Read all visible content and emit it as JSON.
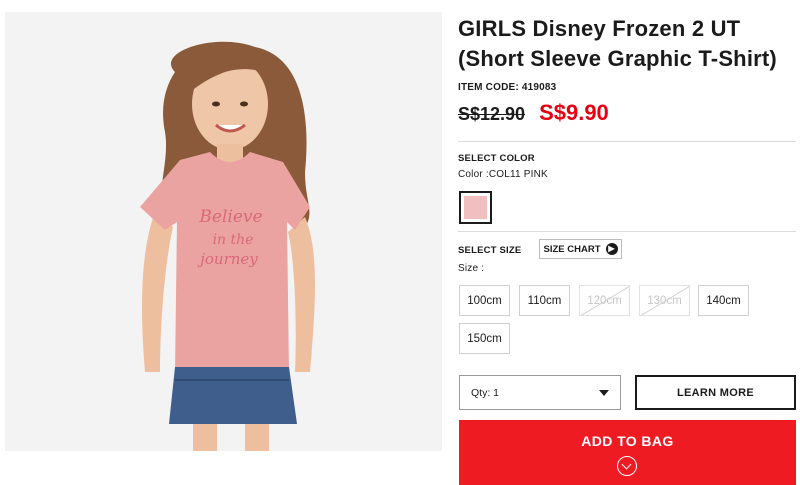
{
  "product": {
    "title_line1": "GIRLS Disney Frozen 2 UT",
    "title_line2": "(Short Sleeve Graphic T-Shirt)",
    "item_code": "ITEM CODE: 419083",
    "price_original": "S$12.90",
    "price_sale": "S$9.90",
    "image_text": [
      "Believe",
      "in the",
      "journey"
    ]
  },
  "color": {
    "section_label": "SELECT COLOR",
    "current": "Color :COL11 PINK",
    "swatch_color": "#f2bfc0"
  },
  "size": {
    "section_label": "SELECT SIZE",
    "chart_button": "SIZE CHART",
    "current": "Size :",
    "options": [
      {
        "label": "100cm",
        "available": true
      },
      {
        "label": "110cm",
        "available": true
      },
      {
        "label": "120cm",
        "available": false
      },
      {
        "label": "130cm",
        "available": false
      },
      {
        "label": "140cm",
        "available": true
      },
      {
        "label": "150cm",
        "available": true
      }
    ]
  },
  "quantity": {
    "label": "Qty: 1"
  },
  "actions": {
    "learn_more": "LEARN MORE",
    "add_to_bag": "ADD TO BAG"
  },
  "colors": {
    "sale_price": "#e60012",
    "add_to_bag_bg": "#ee1b23",
    "text": "#1b1b1b"
  }
}
